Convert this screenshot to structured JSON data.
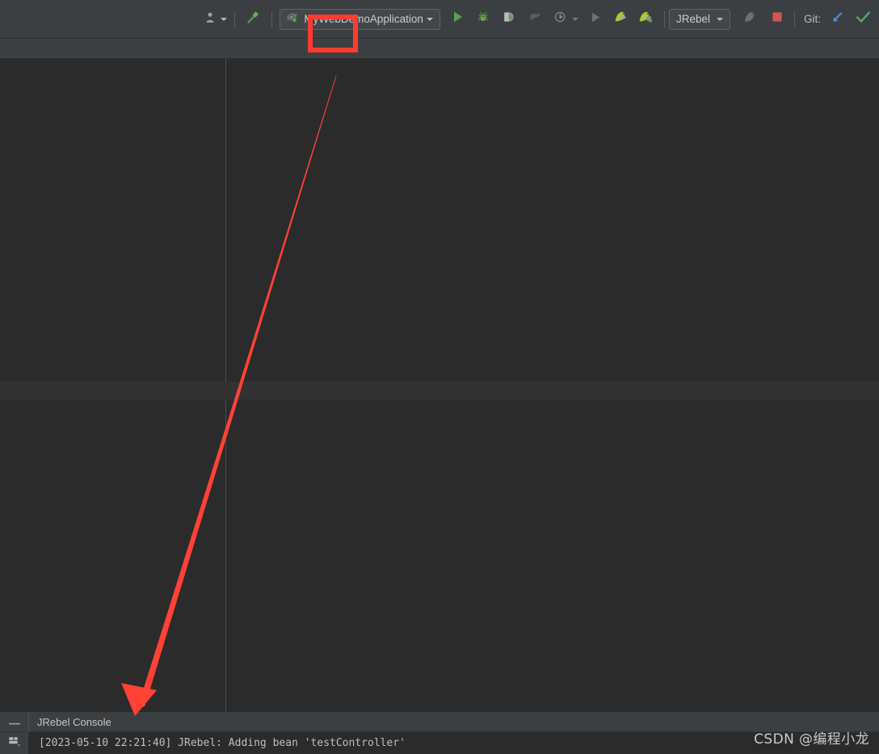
{
  "toolbar": {
    "user_icon": "user-account-icon",
    "build_icon": "build-hammer-icon",
    "run_config": {
      "icon": "spring-boot-run-config-icon",
      "label": "MyWebDemoApplication",
      "dropdown_icon": "chevron-down-icon"
    },
    "actions": [
      {
        "name": "run-button",
        "icon": "run-play-icon",
        "color": "#5c9e4f"
      },
      {
        "name": "debug-button",
        "icon": "debug-bug-icon",
        "color": "#62a558"
      },
      {
        "name": "run-with-coverage-button",
        "icon": "coverage-icon",
        "color": "#9aa0a3"
      },
      {
        "name": "profiler-button",
        "icon": "profiler-icon",
        "color": "#6e7274"
      },
      {
        "name": "run-dashboard-button",
        "icon": "run-services-icon",
        "color": "#8d9295"
      },
      {
        "name": "more-run-options-button",
        "icon": "chevron-down-icon",
        "color": "#8d9295"
      },
      {
        "name": "resume-program-button",
        "icon": "resume-play-icon",
        "color": "#73777a"
      },
      {
        "name": "jrebel-run-button",
        "icon": "jrebel-run-icon",
        "color": "#a5c73a"
      },
      {
        "name": "jrebel-debug-button",
        "icon": "jrebel-debug-icon",
        "color": "#a5c73a"
      }
    ],
    "jrebel": {
      "label": "JRebel",
      "dropdown_icon": "chevron-down-icon"
    },
    "attach_profiler_icon": "attach-process-icon",
    "stop_icon": "stop-square-icon",
    "stop_color": "#cf5655",
    "git": {
      "label": "Git:",
      "update_icon": "update-project-arrow-icon",
      "update_color": "#4a90d9",
      "commit_icon": "commit-checkmark-icon",
      "commit_color": "#59a869"
    }
  },
  "annotation": {
    "box_color": "#ff3b30",
    "box_label": "highlight-rectangle-build-button",
    "arrow_color": "#ff4136",
    "arrow_label": "pointer-arrow-to-console"
  },
  "console": {
    "minimize_icon": "minimize-icon",
    "title": "JRebel Console",
    "gutter_icon": "layout-grid-icon",
    "log_line": "[2023-05-10 22:21:40] JRebel: Adding bean 'testController'"
  },
  "watermark": {
    "text": "CSDN @编程小龙"
  }
}
